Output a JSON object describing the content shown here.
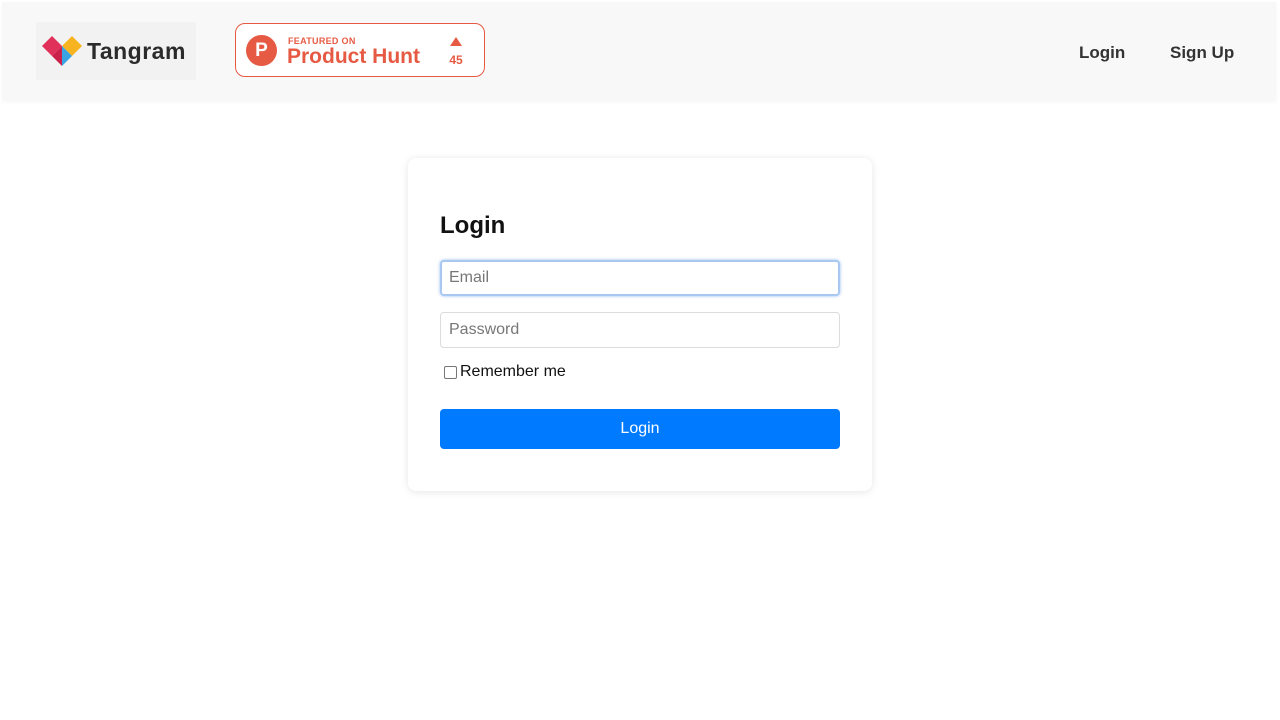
{
  "header": {
    "logo": {
      "text": "Tangram",
      "icon": "tangram-logo-icon",
      "colors": [
        "#e0315a",
        "#f7b320",
        "#3aa3e3"
      ]
    },
    "product_hunt_badge": {
      "icon": "product-hunt-icon",
      "icon_letter": "P",
      "featured_label": "FEATURED ON",
      "name": "Product Hunt",
      "upvote_icon": "upvote-arrow-icon",
      "upvotes": "45",
      "color": "#e65a43"
    },
    "nav": {
      "login_label": "Login",
      "signup_label": "Sign Up"
    }
  },
  "login_form": {
    "title": "Login",
    "email": {
      "placeholder": "Email",
      "value": ""
    },
    "password": {
      "placeholder": "Password",
      "value": ""
    },
    "remember_me": {
      "label": "Remember me",
      "checked": false
    },
    "submit_label": "Login",
    "accent_color": "#007bff"
  }
}
